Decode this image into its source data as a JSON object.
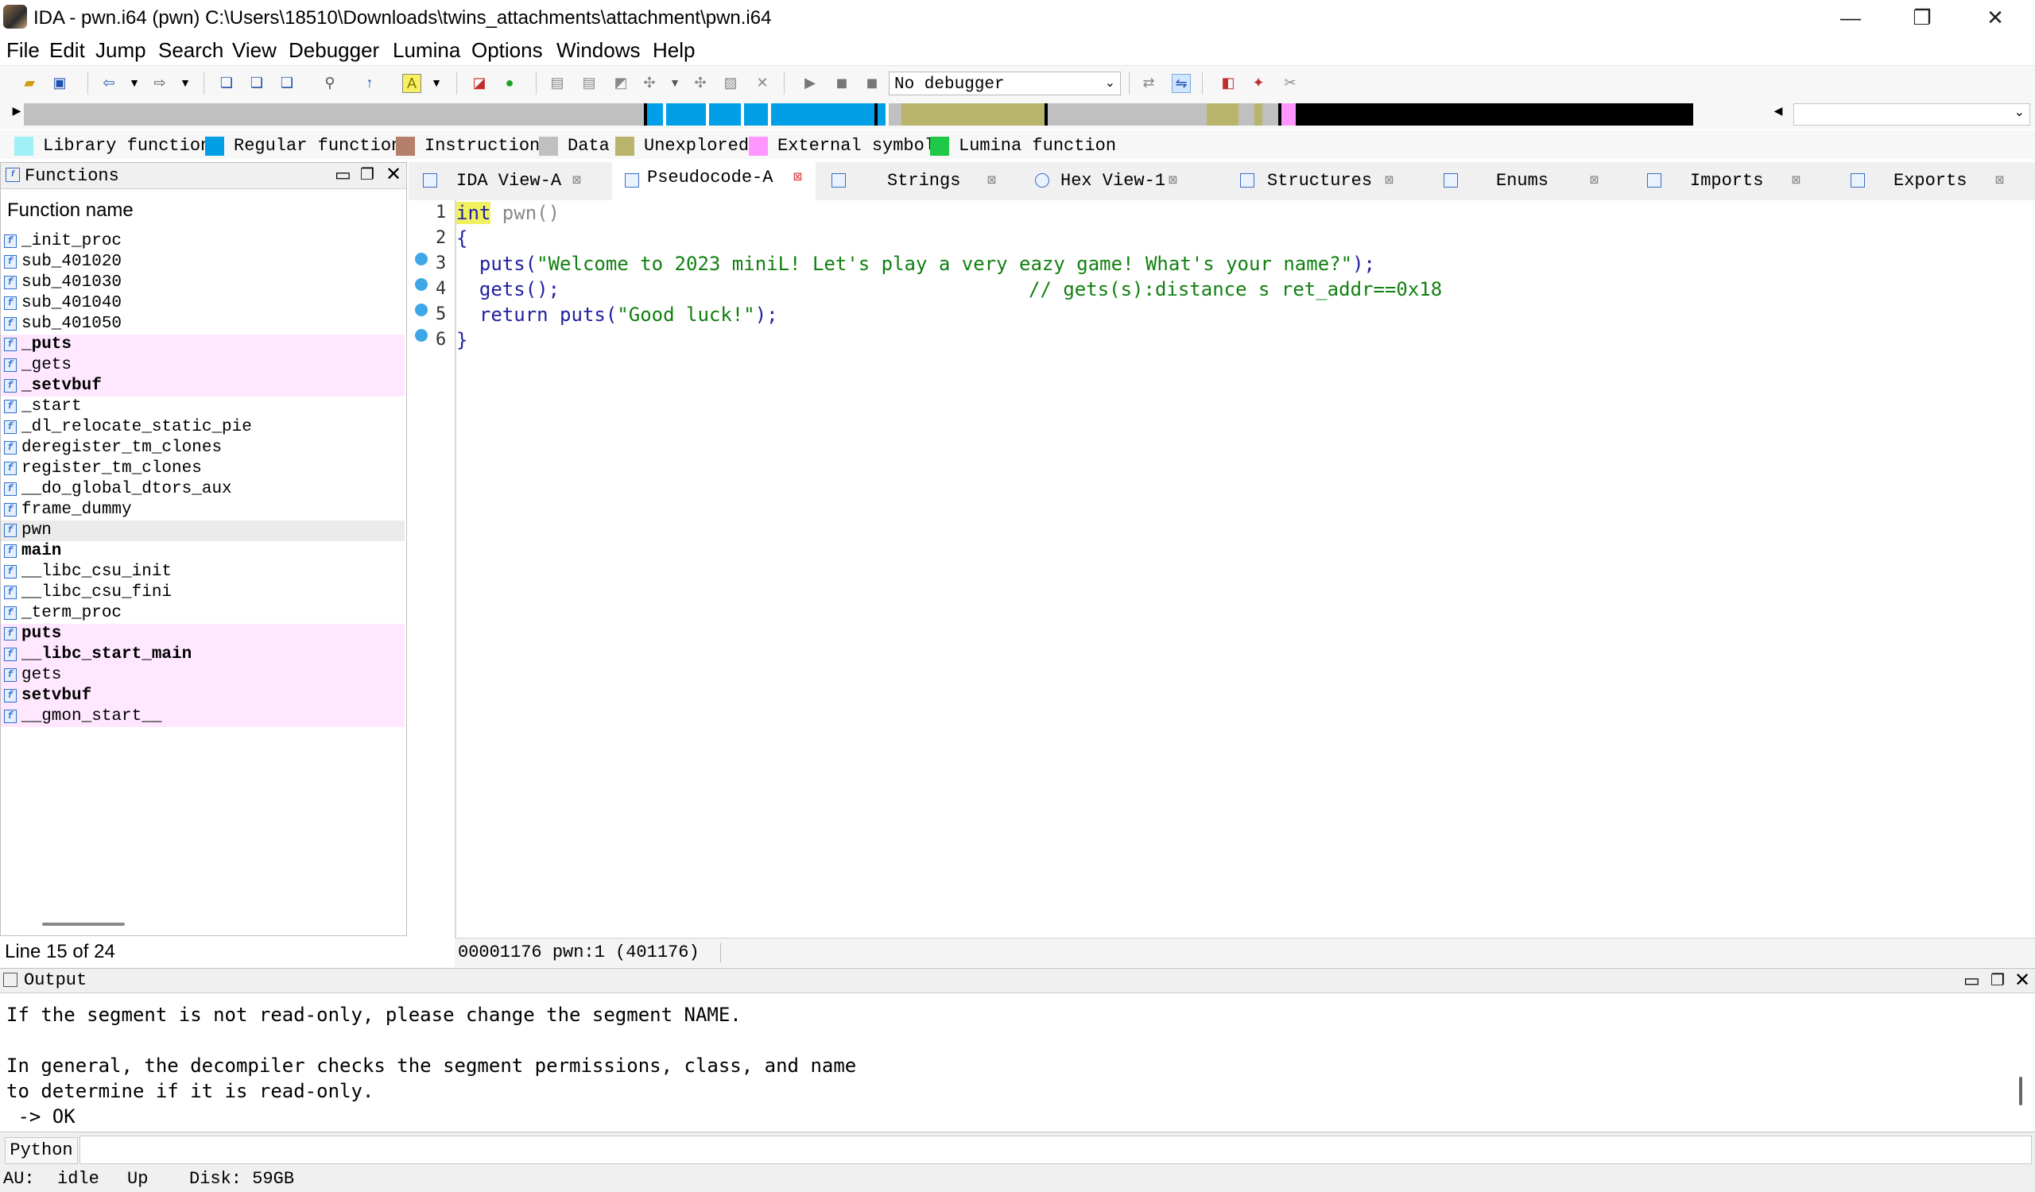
{
  "window": {
    "title": "IDA - pwn.i64 (pwn) C:\\Users\\18510\\Downloads\\twins_attachments\\attachment\\pwn.i64",
    "minimize": "—",
    "maximize": "❐",
    "close": "✕"
  },
  "menu": [
    "File",
    "Edit",
    "Jump",
    "Search",
    "View",
    "Debugger",
    "Lumina",
    "Options",
    "Windows",
    "Help"
  ],
  "toolbar": {
    "debugger_select": "No debugger"
  },
  "legend": [
    {
      "label": "Library function",
      "color": "#a0f0f8"
    },
    {
      "label": "Regular function",
      "color": "#009fe6"
    },
    {
      "label": "Instruction",
      "color": "#b4806c"
    },
    {
      "label": "Data",
      "color": "#c0c0c0"
    },
    {
      "label": "Unexplored",
      "color": "#b8b46c"
    },
    {
      "label": "External symbol",
      "color": "#ff96ff"
    },
    {
      "label": "Lumina function",
      "color": "#20c848"
    }
  ],
  "functions": {
    "title": "Functions",
    "column": "Function name",
    "items": [
      {
        "name": "_init_proc",
        "bold": false,
        "hl": false
      },
      {
        "name": "sub_401020",
        "bold": false,
        "hl": false
      },
      {
        "name": "sub_401030",
        "bold": false,
        "hl": false
      },
      {
        "name": "sub_401040",
        "bold": false,
        "hl": false
      },
      {
        "name": "sub_401050",
        "bold": false,
        "hl": false
      },
      {
        "name": "_puts",
        "bold": true,
        "hl": true
      },
      {
        "name": "_gets",
        "bold": false,
        "hl": true
      },
      {
        "name": "_setvbuf",
        "bold": true,
        "hl": true
      },
      {
        "name": "_start",
        "bold": false,
        "hl": false
      },
      {
        "name": "_dl_relocate_static_pie",
        "bold": false,
        "hl": false
      },
      {
        "name": "deregister_tm_clones",
        "bold": false,
        "hl": false
      },
      {
        "name": "register_tm_clones",
        "bold": false,
        "hl": false
      },
      {
        "name": "__do_global_dtors_aux",
        "bold": false,
        "hl": false
      },
      {
        "name": "frame_dummy",
        "bold": false,
        "hl": false
      },
      {
        "name": "pwn",
        "bold": false,
        "hl": false,
        "sel": true
      },
      {
        "name": "main",
        "bold": true,
        "hl": false
      },
      {
        "name": "__libc_csu_init",
        "bold": false,
        "hl": false
      },
      {
        "name": "__libc_csu_fini",
        "bold": false,
        "hl": false
      },
      {
        "name": "_term_proc",
        "bold": false,
        "hl": false
      },
      {
        "name": "puts",
        "bold": true,
        "hl": true
      },
      {
        "name": "__libc_start_main",
        "bold": true,
        "hl": true
      },
      {
        "name": "gets",
        "bold": false,
        "hl": true
      },
      {
        "name": "setvbuf",
        "bold": true,
        "hl": true
      },
      {
        "name": "__gmon_start__",
        "bold": false,
        "hl": true
      }
    ],
    "status": "Line 15 of 24"
  },
  "tabs": [
    {
      "label": "IDA View-A",
      "active": false
    },
    {
      "label": "Pseudocode-A",
      "active": true
    },
    {
      "label": "Strings",
      "active": false
    },
    {
      "label": "Hex View-1",
      "active": false
    },
    {
      "label": "Structures",
      "active": false
    },
    {
      "label": "Enums",
      "active": false
    },
    {
      "label": "Imports",
      "active": false
    },
    {
      "label": "Exports",
      "active": false
    }
  ],
  "code": {
    "line1_kw": "int",
    "line1_rest": " pwn()",
    "line2": "{",
    "line3_call": "  puts(",
    "line3_str": "\"Welcome to 2023 miniL! Let's play a very eazy game! What's your name?\"",
    "line3_end": ");",
    "line4_call": "  gets();",
    "line4_comment": "// gets(s):distance s ret_addr==0x18",
    "line5_call": "  return puts(",
    "line5_str": "\"Good luck!\"",
    "line5_end": ");",
    "line6": "}",
    "line_numbers": [
      "1",
      "2",
      "3",
      "4",
      "5",
      "6"
    ],
    "status": "00001176 pwn:1 (401176)"
  },
  "output": {
    "title": "Output",
    "lines": [
      "If the segment is not read-only, please change the segment NAME.",
      "",
      "In general, the decompiler checks the segment permissions, class, and name",
      "to determine if it is read-only.",
      " -> OK"
    ]
  },
  "python_button": "Python",
  "statusbar": {
    "au": "AU:",
    "state": "idle",
    "dir": "Up",
    "disk": "Disk: 59GB"
  }
}
